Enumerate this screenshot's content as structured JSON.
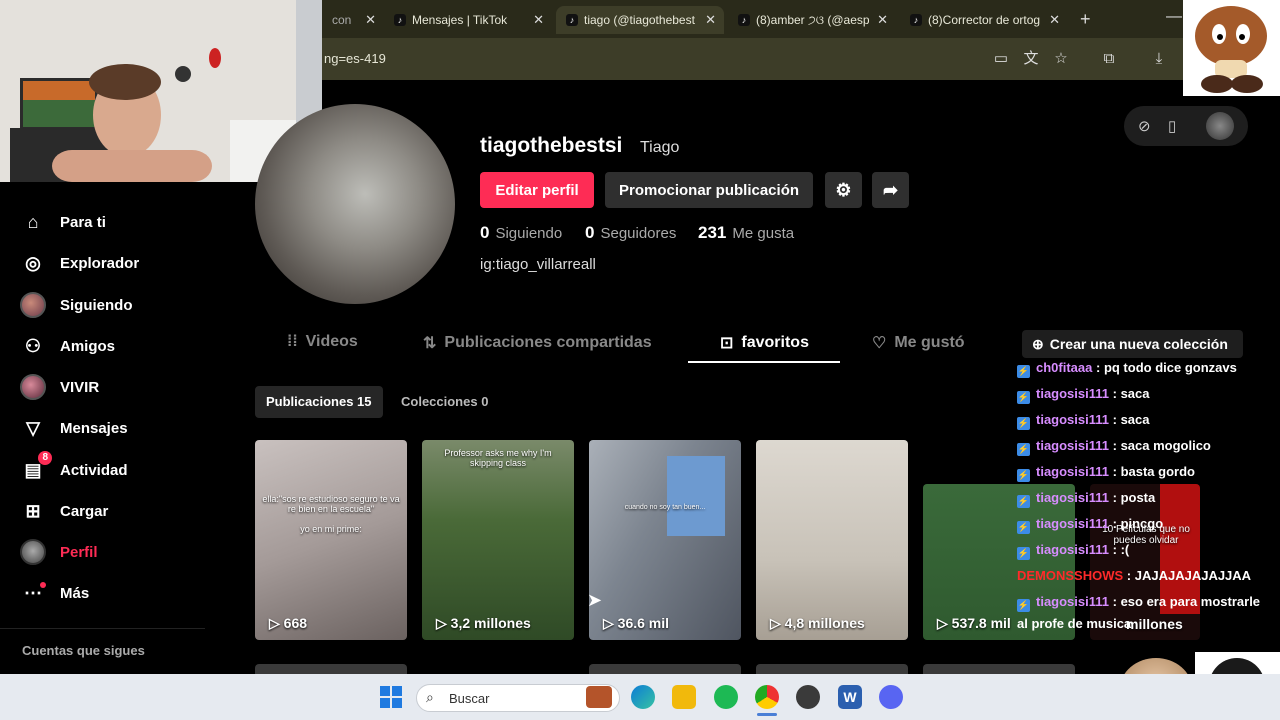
{
  "browser": {
    "tabs": [
      {
        "label": "con",
        "active": false
      },
      {
        "label": "Mensajes | TikTok",
        "active": false
      },
      {
        "label": "tiago (@tiagothebest",
        "active": true
      },
      {
        "label": "(8)amber ੭ଓ (@aesp",
        "active": false
      },
      {
        "label": "(8)Corrector de ortog",
        "active": false
      }
    ],
    "close_glyph": "✕",
    "new_tab_glyph": "+",
    "address": "ng=es-419"
  },
  "sidebar": {
    "items": [
      {
        "label": "Para ti",
        "icon": "home-icon"
      },
      {
        "label": "Explorador",
        "icon": "compass-icon"
      },
      {
        "label": "Siguiendo",
        "icon": "avatar"
      },
      {
        "label": "Amigos",
        "icon": "friends-icon"
      },
      {
        "label": "VIVIR",
        "icon": "avatar"
      },
      {
        "label": "Mensajes",
        "icon": "send-icon"
      },
      {
        "label": "Actividad",
        "icon": "activity-icon",
        "badge": "8"
      },
      {
        "label": "Cargar",
        "icon": "plus-square-icon"
      },
      {
        "label": "Perfil",
        "icon": "avatar",
        "active": true
      },
      {
        "label": "Más",
        "icon": "more-icon"
      }
    ],
    "following_header": "Cuentas que sigues"
  },
  "profile": {
    "username": "tiagothebestsi",
    "display_name": "Tiago",
    "edit_button": "Editar perfil",
    "promote_button": "Promocionar publicación",
    "stats": [
      {
        "value": "0",
        "label": "Siguiendo"
      },
      {
        "value": "0",
        "label": "Seguidores"
      },
      {
        "value": "231",
        "label": "Me gusta"
      }
    ],
    "bio": "ig:tiago_villarreall"
  },
  "tabs": [
    {
      "label": "Videos",
      "active": false
    },
    {
      "label": "Publicaciones compartidas",
      "active": false
    },
    {
      "label": "favoritos",
      "active": true
    },
    {
      "label": "Me gustó",
      "active": false
    }
  ],
  "new_collection_button": "Crear una nueva colección",
  "subtabs": [
    {
      "label": "Publicaciones 15",
      "active": true
    },
    {
      "label": "Colecciones 0",
      "active": false
    }
  ],
  "videos": [
    {
      "views": "668",
      "caption": "ella:\"sos re estudioso seguro te va re bien en la escuela\"\n\nyo en mi prime:"
    },
    {
      "views": "3,2 millones",
      "caption": "Professor asks me why I'm skipping class"
    },
    {
      "views": "36.6 mil",
      "caption": "cuando no soy tan buen..."
    },
    {
      "views": "4,8 millones",
      "caption": ""
    },
    {
      "views": "537.8 mil",
      "caption": ""
    },
    {
      "views": "millones",
      "caption": "10 Películas que no puedes olvidar"
    }
  ],
  "chat": [
    {
      "user": "ch0fitaaa",
      "msg": ": pq todo dice gonzavs"
    },
    {
      "user": "tiagosisi111",
      "msg": ": saca"
    },
    {
      "user": "tiagosisi111",
      "msg": ": saca"
    },
    {
      "user": "tiagosisi111",
      "msg": ": saca mogolico"
    },
    {
      "user": "tiagosisi111",
      "msg": ": basta gordo"
    },
    {
      "user": "tiagosisi111",
      "msg": ": posta"
    },
    {
      "user": "tiagosisi111",
      "msg": ": pincgo"
    },
    {
      "user": "tiagosisi111",
      "msg": ": :("
    },
    {
      "user": "DEMONSSHOWS",
      "msg": ": JAJAJAJAJAJJAA"
    },
    {
      "user": "tiagosisi111",
      "msg": ": eso era para mostrarle"
    },
    {
      "user": "",
      "msg": "al profe de musica"
    }
  ],
  "chat_colors": {
    "default_user": "#d78dff",
    "highlight_user": "#ff2a2a"
  },
  "taskbar": {
    "search_placeholder": "Buscar"
  },
  "colors": {
    "accent": "#fe2c55",
    "background": "#000000",
    "chat_badge": "#3c8ce7"
  }
}
